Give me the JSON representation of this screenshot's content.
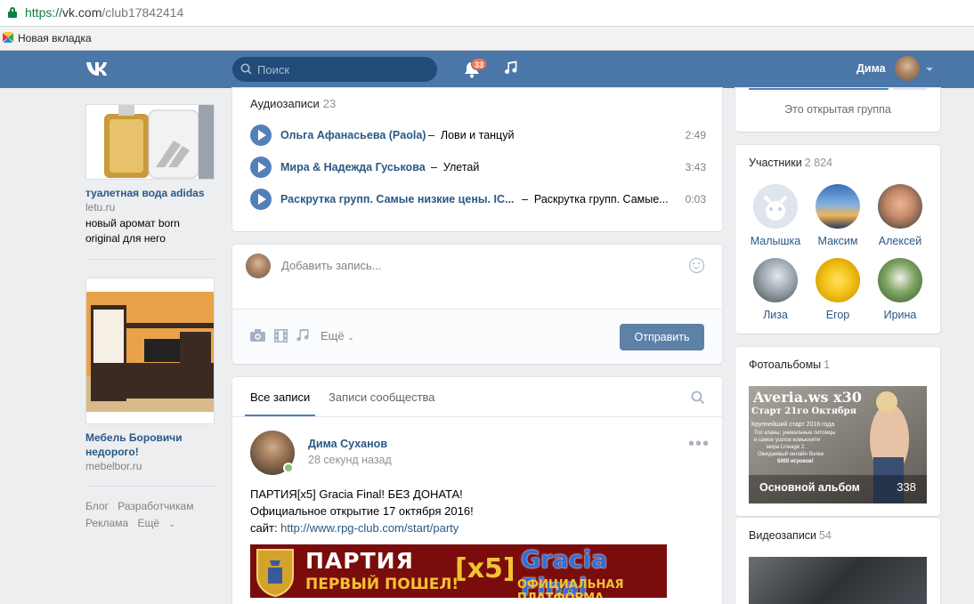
{
  "browser": {
    "url_scheme": "https://",
    "url_host": "vk.com",
    "url_path": "/club17842414",
    "bookmark_label": "Новая вкладка"
  },
  "header": {
    "search_placeholder": "Поиск",
    "notifications_count": "33",
    "user_name": "Дима",
    "brand_color": "#4a76a8"
  },
  "ads": [
    {
      "title": "туалетная вода adidas",
      "domain": "letu.ru",
      "desc": "новый аромат born original для него"
    },
    {
      "title": "Мебель Боровичи недорого!",
      "domain": "mebelbor.ru",
      "desc": ""
    }
  ],
  "footer_links": [
    "Блог",
    "Разработчикам",
    "Реклама",
    "Ещё"
  ],
  "audio": {
    "heading": "Аудиозаписи",
    "count": "23",
    "tracks": [
      {
        "artist": "Ольга Афанасьева (Paola)",
        "title": "Лови и танцуй",
        "duration": "2:49"
      },
      {
        "artist": "Мира & Надежда Гуськова",
        "title": "Улетай",
        "duration": "3:43"
      },
      {
        "artist": "Раскрутка групп. Самые низкие цены. IC...",
        "title": "Раскрутка групп. Самые...",
        "duration": "0:03"
      }
    ]
  },
  "post_form": {
    "placeholder": "Добавить запись...",
    "more_label": "Ещё",
    "send_label": "Отправить"
  },
  "wall": {
    "tabs": [
      "Все записи",
      "Записи сообщества"
    ],
    "post": {
      "author": "Дима Суханов",
      "date": "28 секунд назад",
      "line1": "ПАРТИЯ[x5] Gracia Final! БЕЗ ДОНАТА!",
      "line2": "Официальное открытие 17 октября 2016!",
      "link_prefix": "сайт: ",
      "link": "http://www.rpg-club.com/start/party",
      "banner_title": "ПАРТИЯ",
      "banner_sub": "ПЕРВЫЙ ПОШЕЛ!",
      "banner_x5": "[x5]",
      "banner_right": "Gracia Final",
      "banner_right_sub": "ОФИЦИАЛЬНАЯ ПЛАТФОРМА"
    }
  },
  "right": {
    "group_status": "Это открытая группа",
    "members_heading": "Участники",
    "members_count": "2 824",
    "members": [
      "Малышка",
      "Максим",
      "Алексей",
      "Лиза",
      "Егор",
      "Ирина"
    ],
    "photos_heading": "Фотоальбомы",
    "photos_count": "1",
    "album_title_line1": "Averia.ws x30",
    "album_title_line2": "Старт 21го Октября",
    "album_caption": "Крупнейший старт 2016 года",
    "album_small1": "Топ кланы, уникальные питомцы",
    "album_small2": "и самое ушлое комьюнити",
    "album_small3": "мира Lineage 2.",
    "album_small4": "Ожидаемый онлайн более",
    "album_small5": "5000 игроков!",
    "album_name": "Основной альбом",
    "album_count": "338",
    "videos_heading": "Видеозаписи",
    "videos_count": "54"
  }
}
